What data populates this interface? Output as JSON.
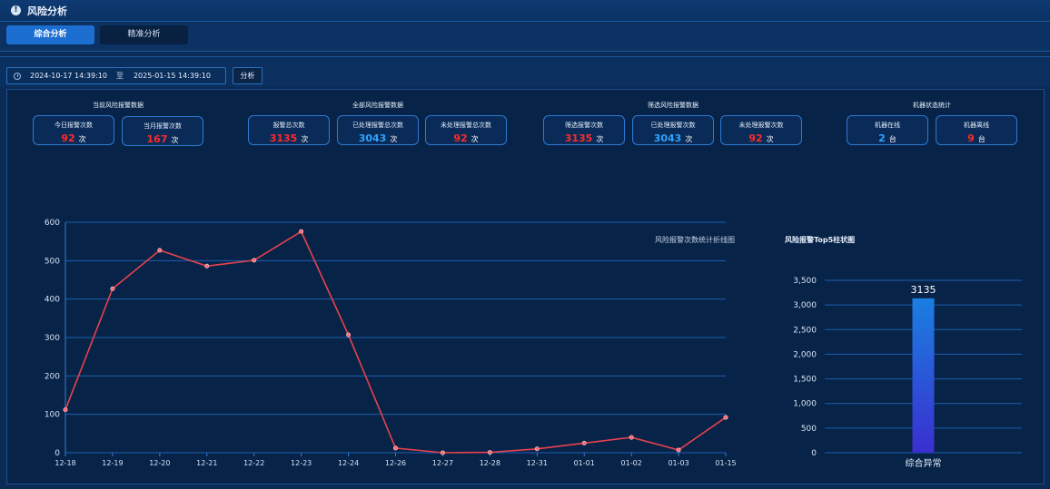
{
  "header": {
    "title": "风险分析",
    "icon": "alert-circle-icon"
  },
  "tabs": [
    {
      "label": "综合分析",
      "active": true
    },
    {
      "label": "精准分析",
      "active": false
    }
  ],
  "filter": {
    "start": "2024-10-17 14:39:10",
    "separator": "至",
    "end": "2025-01-15 14:39:10",
    "analyze_label": "分析"
  },
  "groups": [
    {
      "title": "当前风险报警数据",
      "cards": [
        {
          "label": "今日报警次数",
          "value": "92",
          "unit": "次",
          "color": "#ff2a2a"
        },
        {
          "label": "当月报警次数",
          "value": "167",
          "unit": "次",
          "color": "#ff2a2a"
        }
      ]
    },
    {
      "title": "全部风险报警数据",
      "cards": [
        {
          "label": "报警总次数",
          "value": "3135",
          "unit": "次",
          "color": "#ff2a2a"
        },
        {
          "label": "已处理报警总次数",
          "value": "3043",
          "unit": "次",
          "color": "#2fa3ff"
        },
        {
          "label": "未处理报警总次数",
          "value": "92",
          "unit": "次",
          "color": "#ff2a2a"
        }
      ]
    },
    {
      "title": "筛选风险报警数据",
      "cards": [
        {
          "label": "筛选报警次数",
          "value": "3135",
          "unit": "次",
          "color": "#ff2a2a"
        },
        {
          "label": "已处理报警次数",
          "value": "3043",
          "unit": "次",
          "color": "#2fa3ff"
        },
        {
          "label": "未处理报警次数",
          "value": "92",
          "unit": "次",
          "color": "#ff2a2a"
        }
      ]
    },
    {
      "title": "机器状态统计",
      "cards": [
        {
          "label": "机器在线",
          "value": "2",
          "unit": "台",
          "color": "#2fa3ff"
        },
        {
          "label": "机器离线",
          "value": "9",
          "unit": "台",
          "color": "#ff2a2a"
        }
      ]
    }
  ],
  "chart_data": [
    {
      "type": "line",
      "title": "风险报警次数统计折线图",
      "categories": [
        "12-18",
        "12-19",
        "12-20",
        "12-21",
        "12-22",
        "12-23",
        "12-24",
        "12-26",
        "12-27",
        "12-28",
        "12-31",
        "01-01",
        "01-02",
        "01-03",
        "01-15"
      ],
      "series": [
        {
          "values": [
            112,
            427,
            527,
            486,
            501,
            576,
            307,
            12,
            0,
            1,
            10,
            25,
            40,
            7,
            92
          ]
        }
      ],
      "ylim": [
        0,
        600
      ],
      "yticks": [
        0,
        100,
        200,
        300,
        400,
        500,
        600
      ],
      "grid": true,
      "line_color": "#e8424d"
    },
    {
      "type": "bar",
      "title": "风险报警Top5柱状图",
      "categories": [
        "综合异常"
      ],
      "values": [
        3135
      ],
      "data_labels": [
        "3135"
      ],
      "ylim": [
        0,
        3500
      ],
      "yticks": [
        "0",
        "500",
        "1,000",
        "1,500",
        "2,000",
        "2,500",
        "3,000",
        "3,500"
      ],
      "grid": true,
      "colors": [
        "#1a7fe0",
        "#3a2fd0"
      ]
    }
  ]
}
